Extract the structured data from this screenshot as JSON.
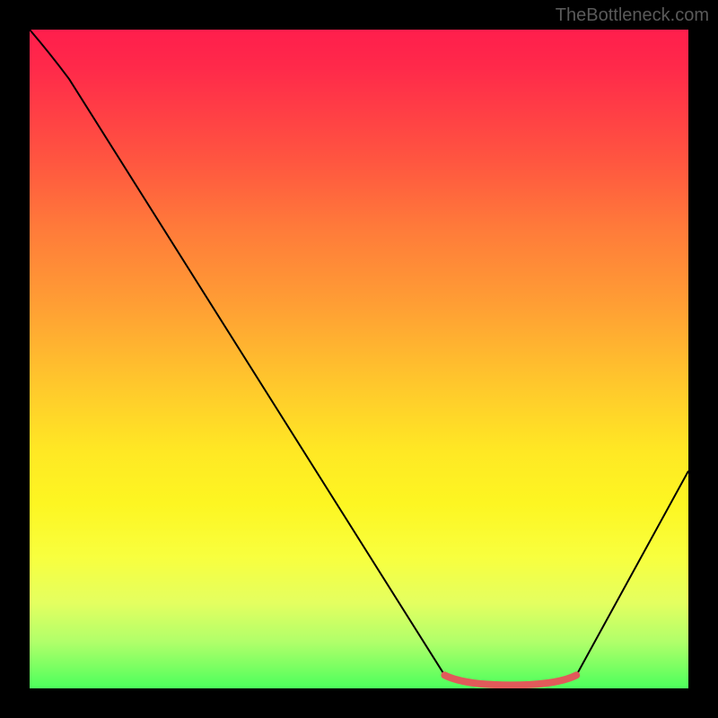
{
  "watermark": "TheBottleneck.com",
  "chart_data": {
    "type": "line",
    "title": "",
    "xlabel": "",
    "ylabel": "",
    "xlim": [
      0,
      100
    ],
    "ylim": [
      0,
      100
    ],
    "series": [
      {
        "name": "bottleneck-curve",
        "points": [
          {
            "x": 0,
            "y": 100
          },
          {
            "x": 3,
            "y": 96.5
          },
          {
            "x": 6,
            "y": 92.5
          },
          {
            "x": 63,
            "y": 2
          },
          {
            "x": 66,
            "y": 0.5
          },
          {
            "x": 80,
            "y": 0.5
          },
          {
            "x": 83,
            "y": 2
          },
          {
            "x": 100,
            "y": 33
          }
        ]
      },
      {
        "name": "highlight-bottom",
        "points": [
          {
            "x": 63,
            "y": 2
          },
          {
            "x": 66,
            "y": 0.5
          },
          {
            "x": 80,
            "y": 0.5
          },
          {
            "x": 83,
            "y": 2
          }
        ]
      }
    ],
    "colors": {
      "curve": "#000000",
      "highlight": "#e15a5a",
      "gradient_top": "#ff1e4c",
      "gradient_bottom": "#4cff5c"
    }
  }
}
